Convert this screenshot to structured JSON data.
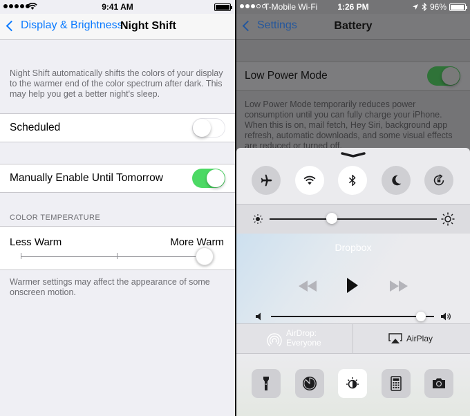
{
  "left": {
    "status": {
      "time": "9:41 AM"
    },
    "nav": {
      "back_label": "Display & Brightness",
      "title": "Night Shift"
    },
    "description": "Night Shift automatically shifts the colors of your display to the warmer end of the color spectrum after dark. This may help you get a better night's sleep.",
    "scheduled": {
      "label": "Scheduled",
      "on": false
    },
    "manual": {
      "label": "Manually Enable Until Tomorrow",
      "on": true
    },
    "color_temperature": {
      "header": "COLOR TEMPERATURE",
      "less_label": "Less Warm",
      "more_label": "More Warm",
      "value": 1.0
    },
    "footer": "Warmer settings may affect the appearance of some onscreen motion."
  },
  "right": {
    "status": {
      "carrier": "T-Mobile Wi-Fi",
      "time": "1:26 PM",
      "battery": "96%"
    },
    "nav": {
      "back_label": "Settings",
      "title": "Battery"
    },
    "low_power": {
      "label": "Low Power Mode",
      "on": true
    },
    "description": "Low Power Mode temporarily reduces power consumption until you can fully charge your iPhone. When this is on, mail fetch, Hey Siri, background app refresh, automatic downloads, and some visual effects are reduced or turned off.",
    "control_center": {
      "toggles": [
        {
          "icon": "airplane-icon",
          "active": false
        },
        {
          "icon": "wifi-icon",
          "active": true
        },
        {
          "icon": "bluetooth-icon",
          "active": true
        },
        {
          "icon": "moon-icon",
          "active": false
        },
        {
          "icon": "rotation-lock-icon",
          "active": false
        }
      ],
      "brightness": 0.37,
      "media": {
        "title": "Dropbox",
        "volume": 0.92
      },
      "airdrop": {
        "line1": "AirDrop:",
        "line2": "Everyone"
      },
      "airplay": {
        "label": "AirPlay"
      },
      "apps": [
        {
          "icon": "flashlight-icon",
          "active": false
        },
        {
          "icon": "timer-icon",
          "active": false
        },
        {
          "icon": "night-shift-icon",
          "active": true
        },
        {
          "icon": "calculator-icon",
          "active": false
        },
        {
          "icon": "camera-icon",
          "active": false
        }
      ]
    }
  },
  "colors": {
    "accent": "#0a7aff",
    "switch_on": "#4cd964"
  }
}
